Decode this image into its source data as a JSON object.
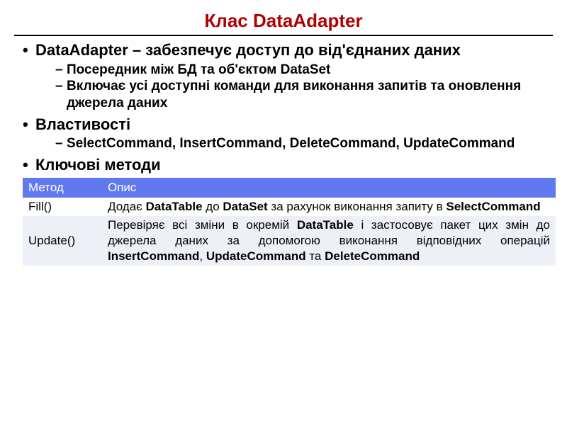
{
  "title": "Клас DataAdapter",
  "bullets": {
    "b1": "DataAdapter – забезпечує доступ до від'єднаних даних",
    "b1_sub1": "Посередник між БД та об'єктом DataSet",
    "b1_sub2": "Включає усі доступні команди для виконання запитів та оновлення джерела даних",
    "b2": "Властивості",
    "b2_sub1": "SelectCommand, InsertCommand, DeleteCommand, UpdateCommand",
    "b3": "Ключові методи"
  },
  "table": {
    "headers": {
      "method": "Метод",
      "desc": "Опис"
    },
    "rows": [
      {
        "method": "Fill()",
        "desc_pre": "Додає ",
        "desc_b1": "DataTable",
        "desc_mid1": " до ",
        "desc_b2": "DataSet",
        "desc_post": " за рахунок виконання запиту в ",
        "desc_b3": "SelectCommand"
      },
      {
        "method": "Update()",
        "desc_pre": "Перевіряє всі зміни в окремій ",
        "desc_b1": "DataTable",
        "desc_mid1": " і застосовує пакет цих змін до джерела даних за допомогою виконання відповідних операцій ",
        "desc_b2": "InsertCommand",
        "desc_mid2": ", ",
        "desc_b3": "UpdateCommand",
        "desc_mid3": " та ",
        "desc_b4": "DeleteCommand"
      }
    ]
  }
}
